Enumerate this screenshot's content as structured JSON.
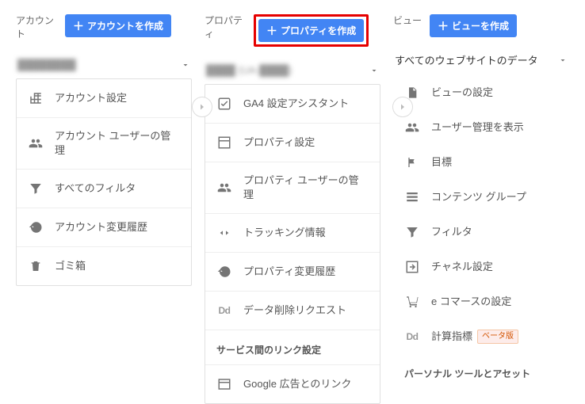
{
  "columns": {
    "account": {
      "title": "アカウント",
      "create_label": "アカウントを作成",
      "selected": "████████",
      "items": [
        {
          "icon": "building",
          "label": "アカウント設定"
        },
        {
          "icon": "users",
          "label": "アカウント ユーザーの管理"
        },
        {
          "icon": "funnel",
          "label": "すべてのフィルタ"
        },
        {
          "icon": "history",
          "label": "アカウント変更履歴"
        },
        {
          "icon": "trash",
          "label": "ゴミ箱"
        }
      ]
    },
    "property": {
      "title": "プロパティ",
      "create_label": "プロパティを作成",
      "selected": "████ (UA-████)",
      "items": [
        {
          "icon": "checkbox",
          "label": "GA4 設定アシスタント"
        },
        {
          "icon": "layout",
          "label": "プロパティ設定"
        },
        {
          "icon": "users",
          "label": "プロパティ ユーザーの管理"
        },
        {
          "icon": "code",
          "label": "トラッキング情報"
        },
        {
          "icon": "history",
          "label": "プロパティ変更履歴"
        },
        {
          "icon": "dd",
          "label": "データ削除リクエスト"
        }
      ],
      "section_heading": "サービス間のリンク設定",
      "link_items": [
        {
          "icon": "adwords",
          "label": "Google 広告とのリンク"
        }
      ]
    },
    "view": {
      "title": "ビュー",
      "create_label": "ビューを作成",
      "selected": "すべてのウェブサイトのデータ",
      "items": [
        {
          "icon": "doc",
          "label": "ビューの設定"
        },
        {
          "icon": "users",
          "label": "ユーザー管理を表示"
        },
        {
          "icon": "flag",
          "label": "目標"
        },
        {
          "icon": "stack",
          "label": "コンテンツ グループ"
        },
        {
          "icon": "funnel",
          "label": "フィルタ"
        },
        {
          "icon": "channel",
          "label": "チャネル設定"
        },
        {
          "icon": "cart",
          "label": "e コマースの設定"
        },
        {
          "icon": "dd",
          "label": "計算指標",
          "badge": "ベータ版"
        }
      ],
      "section_heading": "パーソナル ツールとアセット"
    }
  }
}
